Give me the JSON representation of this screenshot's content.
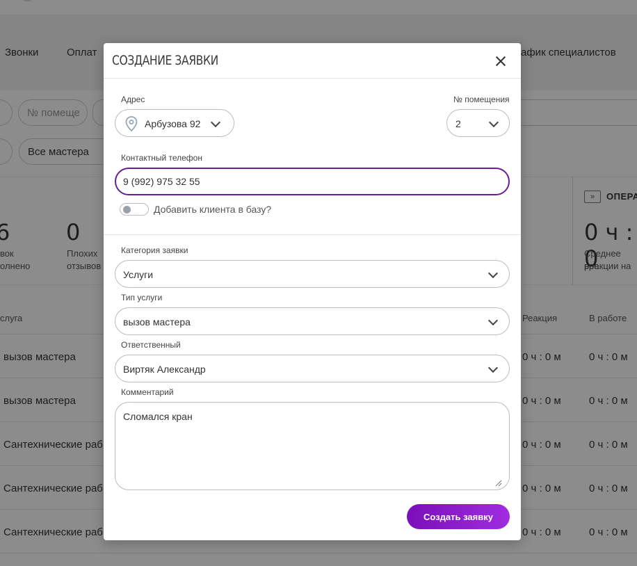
{
  "background": {
    "nav": [
      "Звонки",
      "Оплат",
      "афик специалистов"
    ],
    "filters": {
      "room_placeholder": "№ помеще",
      "masters": "Все мастера"
    },
    "stats": [
      {
        "num": "6",
        "label_1": "вок",
        "label_2": "олнено"
      },
      {
        "num": "0",
        "label_1": "Плохих",
        "label_2": "отзывов"
      }
    ],
    "operative": {
      "title": "ОПЕРАТ",
      "value": "0 ч : 0",
      "label_1": "Среднее вре",
      "label_2": "реакции на"
    },
    "table": {
      "headers": [
        "слуга",
        "Реакция",
        "В работе"
      ],
      "rows": [
        {
          "service": "вызов мастера",
          "reaction": "0 ч : 0 м",
          "work": "0 ч : 0 м"
        },
        {
          "service": "вызов мастера",
          "reaction": "0 ч : 0 м",
          "work": "0 ч : 0 м"
        },
        {
          "service": "Сантехнические раб",
          "reaction": "0 ч : 0 м",
          "work": "0 ч : 0 м"
        },
        {
          "service": "Сантехнические раб",
          "reaction": "0 ч : 0 м",
          "work": "0 ч : 0 м"
        },
        {
          "service": "Сантехнические раб",
          "reaction": "0 ч : 0 м",
          "work": "0 ч : 0 м"
        }
      ]
    }
  },
  "modal": {
    "title": "СОЗДАНИЕ ЗАЯВКИ",
    "address_label": "Адрес",
    "address_value": "Арбузова 92",
    "room_label": "№ помещения",
    "room_value": "2",
    "phone_label": "Контактный телефон",
    "phone_value": "9 (992) 975 32 55",
    "add_client_label": "Добавить клиента в базу?",
    "add_client_enabled": false,
    "category_label": "Категория заявки",
    "category_value": "Услуги",
    "service_type_label": "Тип услуги",
    "service_type_value": "вызов мастера",
    "responsible_label": "Ответственный",
    "responsible_value": "Виртяк Александр",
    "comment_label": "Комментарий",
    "comment_value": "Сломался кран",
    "submit_label": "Создать заявку"
  },
  "colors": {
    "accent": "#6a1b9a",
    "button_gradient_start": "#7a0fb8",
    "button_gradient_end": "#a02de0"
  }
}
